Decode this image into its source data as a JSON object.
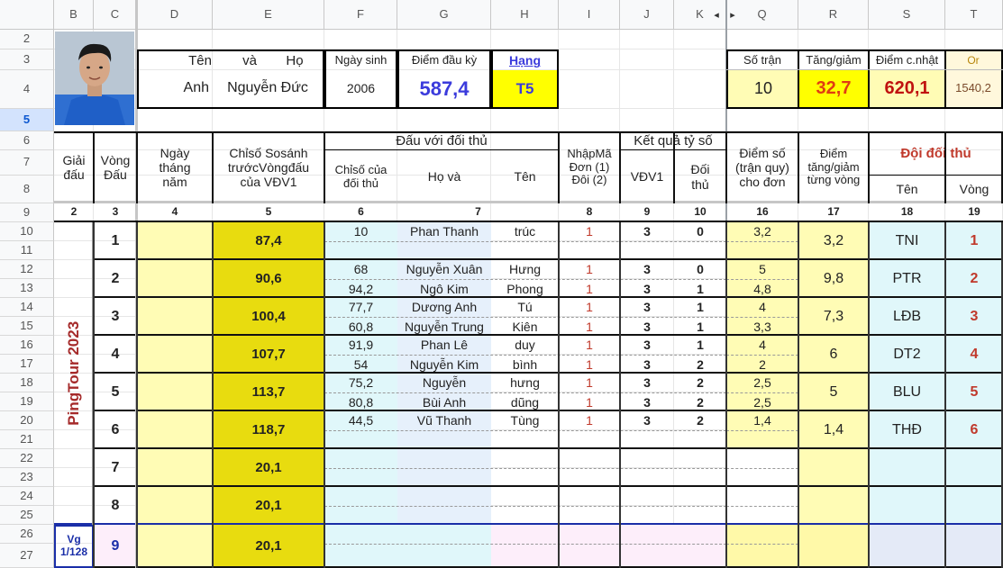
{
  "columns": [
    "B",
    "C",
    "D",
    "E",
    "F",
    "G",
    "H",
    "I",
    "J",
    "K",
    "Q",
    "R",
    "S",
    "T"
  ],
  "rows": [
    "2",
    "3",
    "4",
    "5",
    "6",
    "7",
    "8",
    "9",
    "10",
    "11",
    "12",
    "13",
    "14",
    "15",
    "16",
    "17",
    "18",
    "19",
    "20",
    "21",
    "22",
    "23",
    "24",
    "25",
    "26",
    "27"
  ],
  "profile": {
    "hdr_ten": "Tên",
    "hdr_va": "và",
    "hdr_ho": "Họ",
    "hdr_ngaysinh": "Ngày sinh",
    "hdr_diemdauky": "Điểm đầu kỳ",
    "hdr_hang": "Hạng",
    "first_name": "Anh",
    "last_name": "Nguyễn Đức",
    "birth_year": "2006",
    "start_points": "587,4",
    "rank": "T5"
  },
  "summary": {
    "hdr_sotran": "Số trận",
    "hdr_tanggiam": "Tăng/giảm",
    "hdr_diemcnhat": "Điểm c.nhật",
    "hdr_or": "Or",
    "sotran": "10",
    "tanggiam": "32,7",
    "diemcnhat": "620,1",
    "or": "1540,2"
  },
  "headers": {
    "giai_dau": "Giải\nđấu",
    "vong_dau": "Vòng\nĐấu",
    "ngay": "Ngày\ntháng\nnăm",
    "chiso": "Chỉsố Sosánh\ntrướcVòngđấu\ncủa VĐV1",
    "dau_voi": "Đấu với đối thủ",
    "chiso_dt": "Chỉsố của\nđối thủ",
    "ho_va": "Họ     và",
    "ten": "Tên",
    "nhapma": "NhậpMã\nĐơn (1)\nĐôi (2)",
    "ketqua": "Kết quả tỷ số",
    "vdv1": "VĐV1",
    "doithu": "Đối\nthủ",
    "diemso": "Điểm số\n(trận quy)\ncho đơn",
    "diem_tg": "Điểm\ntăng/giảm\ntừng vòng",
    "doi_doithu": "Đội đối thủ",
    "ten2": "Tên",
    "vong2": "Vòng"
  },
  "col_numbers": [
    "2",
    "3",
    "4",
    "5",
    "6",
    "7",
    "8",
    "9",
    "10",
    "16",
    "17",
    "18",
    "19"
  ],
  "tournament": "PingTour 2023",
  "vg_label": "Vg\n1/128",
  "rounds": [
    {
      "vong": "1",
      "chiso": "87,4",
      "ket": "3,2",
      "team": "TNI",
      "team_v": "1",
      "lines": [
        {
          "cs": "10",
          "ho": "Phan Thanh",
          "ten": "trúc",
          "m": "1",
          "v": "3",
          "d": "0",
          "pts": "3,2"
        },
        {}
      ]
    },
    {
      "vong": "2",
      "chiso": "90,6",
      "ket": "9,8",
      "team": "PTR",
      "team_v": "2",
      "lines": [
        {
          "cs": "68",
          "ho": "Nguyễn Xuân",
          "ten": "Hưng",
          "m": "1",
          "v": "3",
          "d": "0",
          "pts": "5"
        },
        {
          "cs": "94,2",
          "ho": "Ngô Kim",
          "ten": "Phong",
          "m": "1",
          "v": "3",
          "d": "1",
          "pts": "4,8"
        }
      ]
    },
    {
      "vong": "3",
      "chiso": "100,4",
      "ket": "7,3",
      "team": "LĐB",
      "team_v": "3",
      "lines": [
        {
          "cs": "77,7",
          "ho": "Dương Anh",
          "ten": "Tú",
          "m": "1",
          "v": "3",
          "d": "1",
          "pts": "4"
        },
        {
          "cs": "60,8",
          "ho": "Nguyễn Trung",
          "ten": "Kiên",
          "m": "1",
          "v": "3",
          "d": "1",
          "pts": "3,3"
        }
      ]
    },
    {
      "vong": "4",
      "chiso": "107,7",
      "ket": "6",
      "team": "DT2",
      "team_v": "4",
      "lines": [
        {
          "cs": "91,9",
          "ho": "Phan Lê",
          "ten": "duy",
          "m": "1",
          "v": "3",
          "d": "1",
          "pts": "4"
        },
        {
          "cs": "54",
          "ho": "Nguyễn Kim",
          "ten": "bình",
          "m": "1",
          "v": "3",
          "d": "2",
          "pts": "2"
        }
      ]
    },
    {
      "vong": "5",
      "chiso": "113,7",
      "ket": "5",
      "team": "BLU",
      "team_v": "5",
      "lines": [
        {
          "cs": "75,2",
          "ho": "Nguyễn",
          "ten": "hưng",
          "m": "1",
          "v": "3",
          "d": "2",
          "pts": "2,5"
        },
        {
          "cs": "80,8",
          "ho": "Bùi Anh",
          "ten": "dũng",
          "m": "1",
          "v": "3",
          "d": "2",
          "pts": "2,5"
        }
      ]
    },
    {
      "vong": "6",
      "chiso": "118,7",
      "ket": "1,4",
      "team": "THĐ",
      "team_v": "6",
      "lines": [
        {
          "cs": "44,5",
          "ho": "Vũ Thanh",
          "ten": "Tùng",
          "m": "1",
          "v": "3",
          "d": "2",
          "pts": "1,4"
        },
        {}
      ]
    },
    {
      "vong": "7",
      "chiso": "20,1",
      "ket": "",
      "team": "",
      "team_v": "",
      "lines": [
        {},
        {}
      ]
    },
    {
      "vong": "8",
      "chiso": "20,1",
      "ket": "",
      "team": "",
      "team_v": "",
      "lines": [
        {},
        {}
      ]
    },
    {
      "vong": "9",
      "chiso": "20,1",
      "ket": "",
      "team": "",
      "team_v": "",
      "lines": [
        {},
        {}
      ]
    }
  ],
  "colors": {
    "yellow_light": "#fffcb5",
    "yellow_dark": "#e8dc0f",
    "cyan": "#e0f7fa",
    "blue_light": "#e6f0fb",
    "dotted": "#f0ecf8",
    "pink": "#fdeefa",
    "pink_dark": "#f3d4f0",
    "rank_yellow": "#ffff00",
    "red": "#c0392b",
    "blue": "#3b3bdc",
    "header_text": "#555555"
  }
}
